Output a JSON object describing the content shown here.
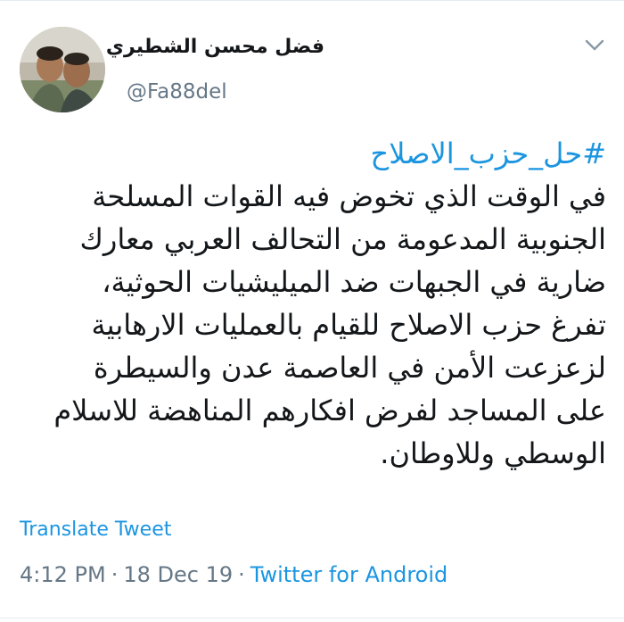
{
  "author": {
    "display_name": "فضل محسن الشطيري",
    "handle": "@Fa88del",
    "avatar": "avatar-photo"
  },
  "menu_icon": "chevron-down-icon",
  "tweet": {
    "hashtag": "#حل_حزب_الاصلاح",
    "lines": [
      "في الوقت الذي تخوض فيه القوات المسلحة",
      "الجنوبية المدعومة من التحالف العربي معارك",
      "ضارية في الجبهات ضد الميليشيات الحوثية،",
      "تفرغ حزب الاصلاح للقيام بالعمليات الارهابية",
      "لزعزعت الأمن في العاصمة عدن والسيطرة",
      "على المساجد لفرض افكارهم المناهضة للاسلام",
      "الوسطي وللاوطان."
    ]
  },
  "translate_label": "Translate Tweet",
  "meta": {
    "time": "4:12 PM",
    "separator": "·",
    "date": "18 Dec 19",
    "source": "Twitter for Android"
  },
  "colors": {
    "link": "#1b95e0",
    "secondary": "#657786",
    "text": "#14171a"
  }
}
